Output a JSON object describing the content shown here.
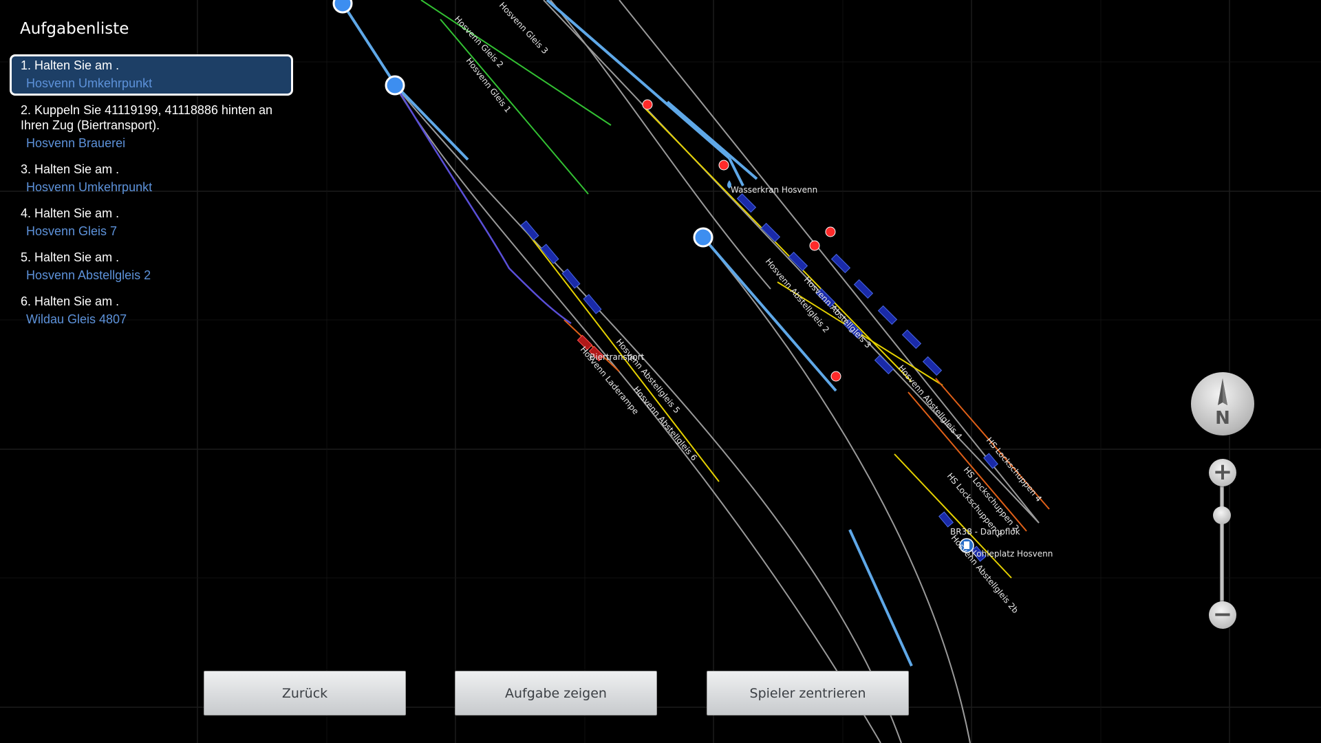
{
  "panel": {
    "title": "Aufgabenliste"
  },
  "tasks": [
    {
      "text": "1. Halten Sie am .",
      "place": "Hosvenn Umkehrpunkt",
      "active": true
    },
    {
      "text": "2. Kuppeln Sie 41119199, 41118886 hinten an Ihren Zug (Biertransport).",
      "place": "Hosvenn Brauerei",
      "active": false
    },
    {
      "text": "3. Halten Sie am .",
      "place": "Hosvenn Umkehrpunkt",
      "active": false
    },
    {
      "text": "4. Halten Sie am .",
      "place": "Hosvenn Gleis 7",
      "active": false
    },
    {
      "text": "5. Halten Sie am .",
      "place": "Hosvenn Abstellgleis 2",
      "active": false
    },
    {
      "text": "6. Halten Sie am .",
      "place": "Wildau Gleis 4807",
      "active": false
    }
  ],
  "buttons": {
    "back": "Zurück",
    "show_task": "Aufgabe zeigen",
    "center_player": "Spieler zentrieren"
  },
  "compass": {
    "letter": "N"
  },
  "zoom": {
    "plus": "+",
    "minus": "−"
  },
  "map": {
    "track_labels": {
      "gleis3": "Hosvenn Gleis 3",
      "gleis2": "Hosvenn Gleis 2",
      "gleis1": "Hosvenn Gleis 1",
      "abstell2": "Hosvenn Abstellgleis 2",
      "abstell3": "Hosvenn Abstellgleis 3",
      "abstell4": "Hosvenn Abstellgleis 4",
      "abstell5": "Hosvenn Abstellgleis 5",
      "abstell6": "Hosvenn Abstellgleis 6",
      "laderampe": "Hosvenn Laderampe",
      "lok4": "HS Lockschuppen 4",
      "lok2": "HS Lockschuppen 2",
      "lok1": "HS Lockschuppen 1",
      "abstell2b": "Hosvenn Abstellgleis 2b"
    },
    "poi_labels": {
      "wasserkran": "Wasserkran Hosvenn",
      "biertransport": "Biertransport",
      "br38": "BR38 - Dampflok",
      "kohleplatz": "Kohleplatz Hosvenn"
    },
    "colors": {
      "background": "#000000",
      "grid": "#1c1c1c",
      "track_gray": "#9a9a9a",
      "track_yellow": "#e6d200",
      "track_green": "#33c233",
      "track_orange": "#e06018",
      "route_blue": "#5fa8e8",
      "route_purple": "#5a4fd8",
      "wagon": "#1a2aa8",
      "signal_red": "#ff2a2a",
      "node_blue": "#3d8ef0",
      "train_red": "#b01818"
    }
  }
}
